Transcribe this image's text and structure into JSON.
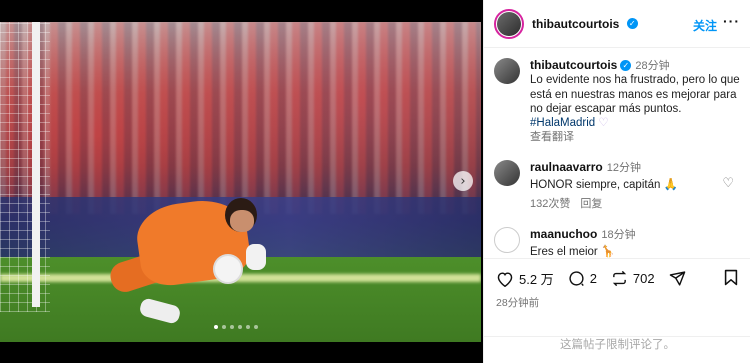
{
  "post": {
    "username": "thibautcourtois",
    "follow_label": "关注",
    "more_label": "···",
    "caption": {
      "username": "thibautcourtois",
      "time": "28分钟",
      "text": "Lo evidente nos ha frustrado, pero lo que está en nuestras manos es mejorar para no dejar escapar más puntos.",
      "hashtag": "#HalaMadrid",
      "emoji": "♡",
      "see_translation": "查看翻译"
    },
    "comments": [
      {
        "username": "raulnaavarro",
        "time": "12分钟",
        "text": "HONOR siempre, capitán 🙏",
        "likes": "132次赞",
        "reply": "回复"
      },
      {
        "username": "maanuchoo",
        "time": "18分钟",
        "text": "Eres el meior 🦒",
        "likes": "",
        "reply": ""
      }
    ],
    "actions": {
      "likes": "5.2 万",
      "comments": "2",
      "reposts": "702"
    },
    "posted_time": "28分钟前",
    "footer_text": "这篇帖子限制评论了。"
  },
  "media": {
    "next_label": "›",
    "carousel_total": 6,
    "carousel_active": 1
  },
  "colors": {
    "accent": "#0095f6",
    "kit": "#f07a2a"
  }
}
